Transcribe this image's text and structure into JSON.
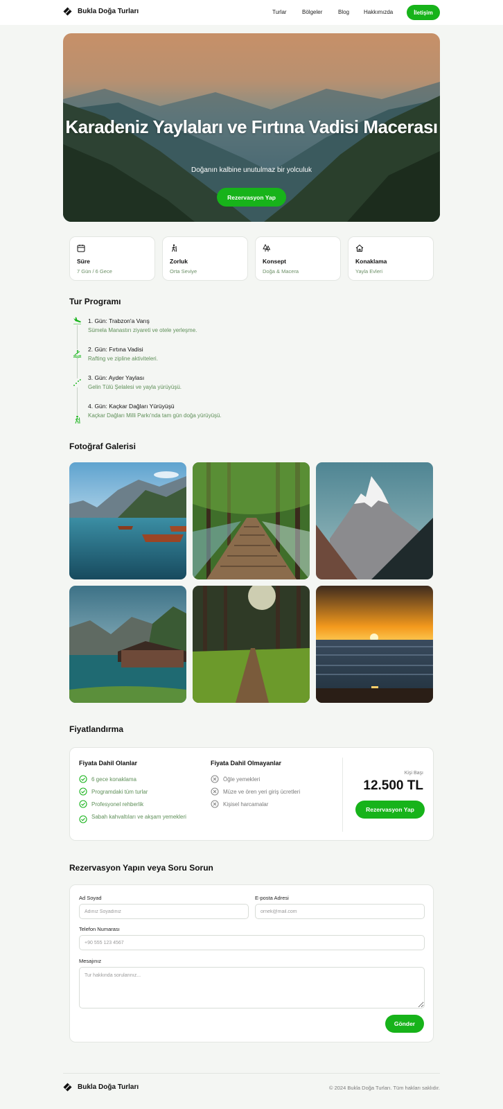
{
  "brand": {
    "name": "Bukla Doğa Turları"
  },
  "nav": {
    "links": [
      "Turlar",
      "Bölgeler",
      "Blog",
      "Hakkımızda"
    ],
    "cta": "İletişim"
  },
  "hero": {
    "title": "Karadeniz Yaylaları ve Fırtına Vadisi Macerası",
    "subtitle": "Doğanın kalbine unutulmaz bir yolculuk",
    "cta": "Rezervasyon Yap"
  },
  "info_cards": [
    {
      "icon": "calendar-icon",
      "label": "Süre",
      "value": "7 Gün / 6 Gece"
    },
    {
      "icon": "hiker-icon",
      "label": "Zorluk",
      "value": "Orta Seviye"
    },
    {
      "icon": "trees-icon",
      "label": "Konsept",
      "value": "Doğa & Macera"
    },
    {
      "icon": "home-icon",
      "label": "Konaklama",
      "value": "Yayla Evleri"
    }
  ],
  "program": {
    "title": "Tur Programı",
    "days": [
      {
        "icon": "plane-landing-icon",
        "title": "1. Gün: Trabzon'a Varış",
        "desc": "Sümela Manastırı ziyareti ve otele yerleşme."
      },
      {
        "icon": "rafting-icon",
        "title": "2. Gün: Fırtına Vadisi",
        "desc": "Rafting ve zipline aktiviteleri."
      },
      {
        "icon": "trail-icon",
        "title": "3. Gün: Ayder Yaylası",
        "desc": "Gelin Tülü Şelalesi ve yayla yürüyüşü."
      },
      {
        "icon": "hiker-icon",
        "title": "4. Gün: Kaçkar Dağları Yürüyüşü",
        "desc": "Kaçkar Dağları Milli Parkı'nda tam gün doğa yürüyüşü."
      }
    ]
  },
  "gallery": {
    "title": "Fotoğraf Galerisi"
  },
  "pricing": {
    "title": "Fiyatlandırma",
    "included_title": "Fiyata Dahil Olanlar",
    "included": [
      "6 gece konaklama",
      "Programdaki tüm turlar",
      "Profesyonel rehberlik",
      "Sabah kahvaltıları ve akşam yemekleri"
    ],
    "excluded_title": "Fiyata Dahil Olmayanlar",
    "excluded": [
      "Öğle yemekleri",
      "Müze ve ören yeri giriş ücretleri",
      "Kişisel harcamalar"
    ],
    "per_person": "Kişi Başı",
    "price": "12.500 TL",
    "cta": "Rezervasyon Yap"
  },
  "form": {
    "title": "Rezervasyon Yapın veya Soru Sorun",
    "name_label": "Ad Soyad",
    "name_placeholder": "Adınız Soyadınız",
    "email_label": "E-posta Adresi",
    "email_placeholder": "ornek@mail.com",
    "phone_label": "Telefon Numarası",
    "phone_placeholder": "+90 555 123 4567",
    "message_label": "Mesajınız",
    "message_placeholder": "Tur hakkında sorularınız...",
    "submit": "Gönder"
  },
  "footer": {
    "brand": "Bukla Doğa Turları",
    "copyright": "© 2024 Bukla Doğa Turları. Tüm hakları saklıdır."
  },
  "colors": {
    "accent": "#17b31a",
    "muted_green": "#5e8f58",
    "background": "#f4f6f3"
  }
}
